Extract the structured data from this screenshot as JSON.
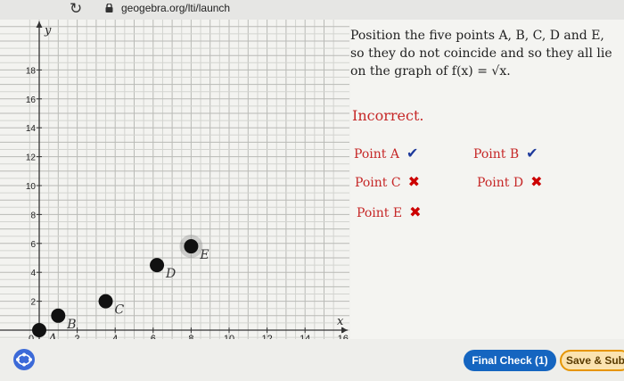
{
  "browser": {
    "url": "geogebra.org/lti/launch"
  },
  "graph": {
    "y_ticks": [
      "18",
      "16",
      "14",
      "12",
      "10",
      "8",
      "6",
      "4",
      "2"
    ],
    "x_ticks": [
      "2",
      "4",
      "6",
      "8",
      "10",
      "12",
      "14",
      "16"
    ],
    "origin_label": "0",
    "x_axis_label": "x",
    "y_axis_label": "y",
    "points": [
      {
        "name": "A",
        "x": 0,
        "y": 0,
        "highlighted": false
      },
      {
        "name": "B",
        "x": 1,
        "y": 1,
        "highlighted": false
      },
      {
        "name": "C",
        "x": 3.5,
        "y": 2,
        "highlighted": false
      },
      {
        "name": "D",
        "x": 6.2,
        "y": 4.5,
        "highlighted": false
      },
      {
        "name": "E",
        "x": 8,
        "y": 5.8,
        "highlighted": true
      }
    ]
  },
  "panel": {
    "task_text": "Position the five points A, B, C, D and E, so they do not coincide and so they all lie on the graph of f(x) = √x.",
    "feedback": "Incorrect.",
    "statuses": [
      {
        "label": "Point A",
        "status": "correct"
      },
      {
        "label": "Point B",
        "status": "correct"
      },
      {
        "label": "Point C",
        "status": "incorrect"
      },
      {
        "label": "Point D",
        "status": "incorrect"
      },
      {
        "label": "Point E",
        "status": "incorrect"
      }
    ],
    "icons": {
      "correct": "✔",
      "incorrect": "✖"
    }
  },
  "buttons": {
    "final_check": "Final Check (1)",
    "save": "Save & Sub"
  },
  "colors": {
    "primary": "#1565c0",
    "error": "#c62828",
    "check_blue": "#1e3a9c"
  }
}
